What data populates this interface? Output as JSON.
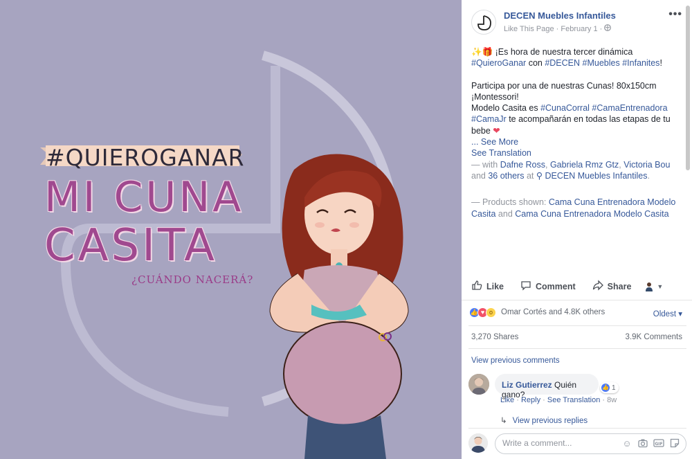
{
  "photo": {
    "banner": "#QUIEROGANAR",
    "title_line1": "MI CUNA",
    "title_line2": "CASITA",
    "subtitle": "¿CUÁNDO NACERÁ?"
  },
  "post": {
    "page_name": "DECEN Muebles Infantiles",
    "like_page": "Like This Page",
    "separator": "·",
    "date": "February 1",
    "privacy_icon": "globe-icon",
    "more_icon": "ellipsis-icon",
    "more": "•••",
    "text": {
      "p1_emoji": "✨🎁",
      "p1_a": " ¡Es hora de nuestra tercer dinámica ",
      "tag_quieroganar": "#QuieroGanar",
      "p1_b": " con ",
      "tag_decen": "#DECEN",
      "tag_muebles": "#Muebles",
      "tag_infantiles": "#Infanites",
      "p1_c": "!",
      "p2_line1": "Participa por una de nuestras Cunas! 80x150cm",
      "p2_line2": "¡Montessori!",
      "p2_line3": "Modelo Casita es ",
      "tag_cunacorral": "#CunaCorral",
      "tag_camaentrenadora": "#CamaEntrenadora",
      "tag_camajr": "#CamaJr",
      "p2_line4": " te acompañarán en todas las etapas de tu bebe ",
      "heart": "❤",
      "ellipsis": "... ",
      "see_more": "See More",
      "see_translation": "See Translation",
      "with_prefix": "— with ",
      "tag1": "Dafne Ross",
      "tag2": "Gabriela Rmz Gtz",
      "tag3": "Victoria Bou",
      "and": "and ",
      "others": "36 others",
      "at": " at ",
      "location": "DECEN Muebles Infantiles",
      "period": ".",
      "products_prefix": "— Products shown: ",
      "product1": "Cama Cuna Entrenadora Modelo Casita",
      "and2": " and ",
      "product2": "Cama Cuna Entrenadora Modelo Casita"
    }
  },
  "actions": {
    "like": "Like",
    "comment": "Comment",
    "share": "Share",
    "like_icon": "thumbs-up-icon",
    "comment_icon": "speech-bubble-icon",
    "share_icon": "share-arrow-icon"
  },
  "reactions": {
    "summary": "Omar Cortés and 4.8K others",
    "sort": "Oldest ▾",
    "icons": [
      "like-reaction-icon",
      "love-reaction-icon",
      "wow-reaction-icon"
    ]
  },
  "counts": {
    "shares": "3,270 Shares",
    "comments": "3.9K Comments"
  },
  "comments": {
    "view_previous": "View previous comments",
    "items": [
      {
        "author": "Liz Gutierrez",
        "text": "Quién gano?",
        "reaction_count": "1",
        "like": "Like",
        "reply": "Reply",
        "see_translation": "See Translation",
        "dot": " · ",
        "age": "8w"
      }
    ],
    "view_previous_replies": "View previous replies",
    "composer_placeholder": "Write a comment...",
    "composer_icons": [
      "emoji-icon",
      "camera-icon",
      "gif-icon",
      "sticker-icon"
    ]
  },
  "colors": {
    "photo_bg": "#a7a4c0",
    "link": "#365899",
    "meta": "#90949c",
    "title_purple": "#a0498f"
  }
}
